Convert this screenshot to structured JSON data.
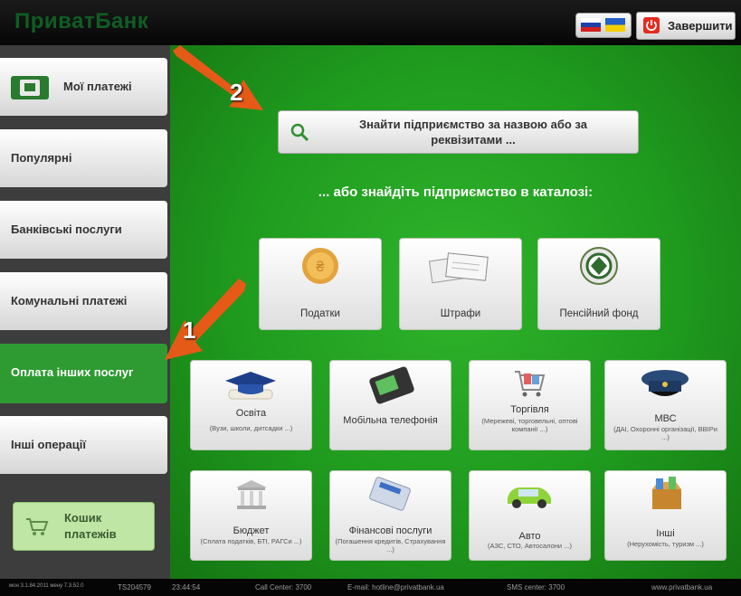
{
  "header": {
    "logo": "ПриватБанк",
    "finish_label": "Завершити"
  },
  "sidebar": {
    "items": [
      {
        "label": "Мої платежі"
      },
      {
        "label": "Популярні"
      },
      {
        "label": "Банківські послуги"
      },
      {
        "label": "Комунальні платежі"
      },
      {
        "label": "Оплата інших послуг"
      },
      {
        "label": "Інші операції"
      }
    ],
    "cart_label": "Кошик платежів"
  },
  "main": {
    "search_label": "Знайти підприємство за назвою або за реквізитами ...",
    "catalog_title": "... або знайдіть підприємство в каталозі:",
    "top_tiles": [
      {
        "label": "Податки"
      },
      {
        "label": "Штрафи"
      },
      {
        "label": "Пенсійний фонд"
      }
    ],
    "tiles": [
      {
        "label": "Освіта",
        "sub": "(Вузи, школи, дитсадки ...)"
      },
      {
        "label": "Мобільна телефонія",
        "sub": ""
      },
      {
        "label": "Торгівля",
        "sub": "(Мережеві, торговельні, оптові компанії ...)"
      },
      {
        "label": "МВС",
        "sub": "(ДАІ, Охоронні організації, ВВІРи ...)"
      },
      {
        "label": "Бюджет",
        "sub": "(Сплата податків, БТІ, РАГСи ...)"
      },
      {
        "label": "Фінансові послуги",
        "sub": "(Погашення кредитів, Страхування ...)"
      },
      {
        "label": "Авто",
        "sub": "(АЗС, СТО, Автосалони ...)"
      },
      {
        "label": "Інші",
        "sub": "(Нерухомість, туризм ...)"
      }
    ]
  },
  "annotations": {
    "arrow1": "1",
    "arrow2": "2"
  },
  "footer": {
    "version": "мон 3.1.84.2011  мену 7.3.52.0",
    "terminal": "TS204579",
    "time": "23:44:54",
    "call_center": "Call Center: 3700",
    "email": "E-mail: hotline@privatbank.ua",
    "sms": "SMS center: 3700",
    "site": "www.privatbank.ua"
  },
  "colors": {
    "accent_green": "#2e9b32",
    "arrow_orange": "#e55a16"
  }
}
